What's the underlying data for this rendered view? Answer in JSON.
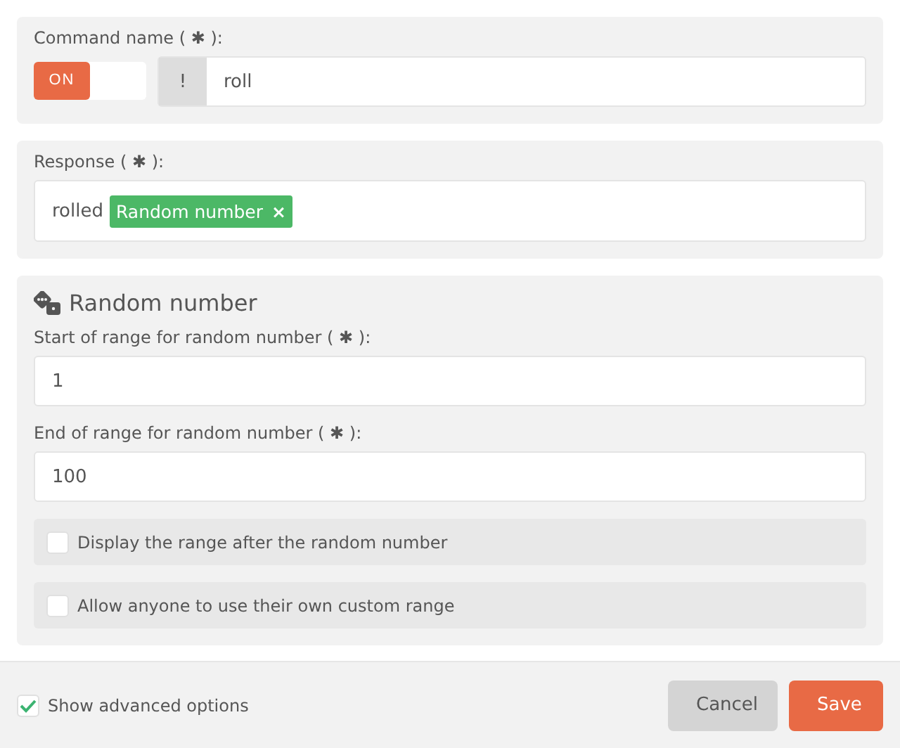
{
  "command": {
    "label": "Command name ( ✱ ):",
    "toggle": {
      "label": "ON",
      "on": true
    },
    "prefix": "!",
    "value": "roll"
  },
  "response": {
    "label": "Response ( ✱ ):",
    "text": "rolled",
    "tag": {
      "label": "Random number",
      "remove": "×"
    }
  },
  "random_number": {
    "title": "Random number",
    "fields": [
      {
        "label": "Start of range for random number ( ✱ ):",
        "value": "1"
      },
      {
        "label": "End of range for random number ( ✱ ):",
        "value": "100"
      }
    ],
    "options": [
      {
        "label": "Display the range after the random number",
        "checked": false
      },
      {
        "label": "Allow anyone to use their own custom range",
        "checked": false
      }
    ]
  },
  "footer": {
    "advanced": {
      "label": "Show advanced options",
      "checked": true
    },
    "buttons": [
      {
        "label": "Cancel",
        "kind": "secondary"
      },
      {
        "label": "Save",
        "kind": "primary"
      }
    ]
  }
}
